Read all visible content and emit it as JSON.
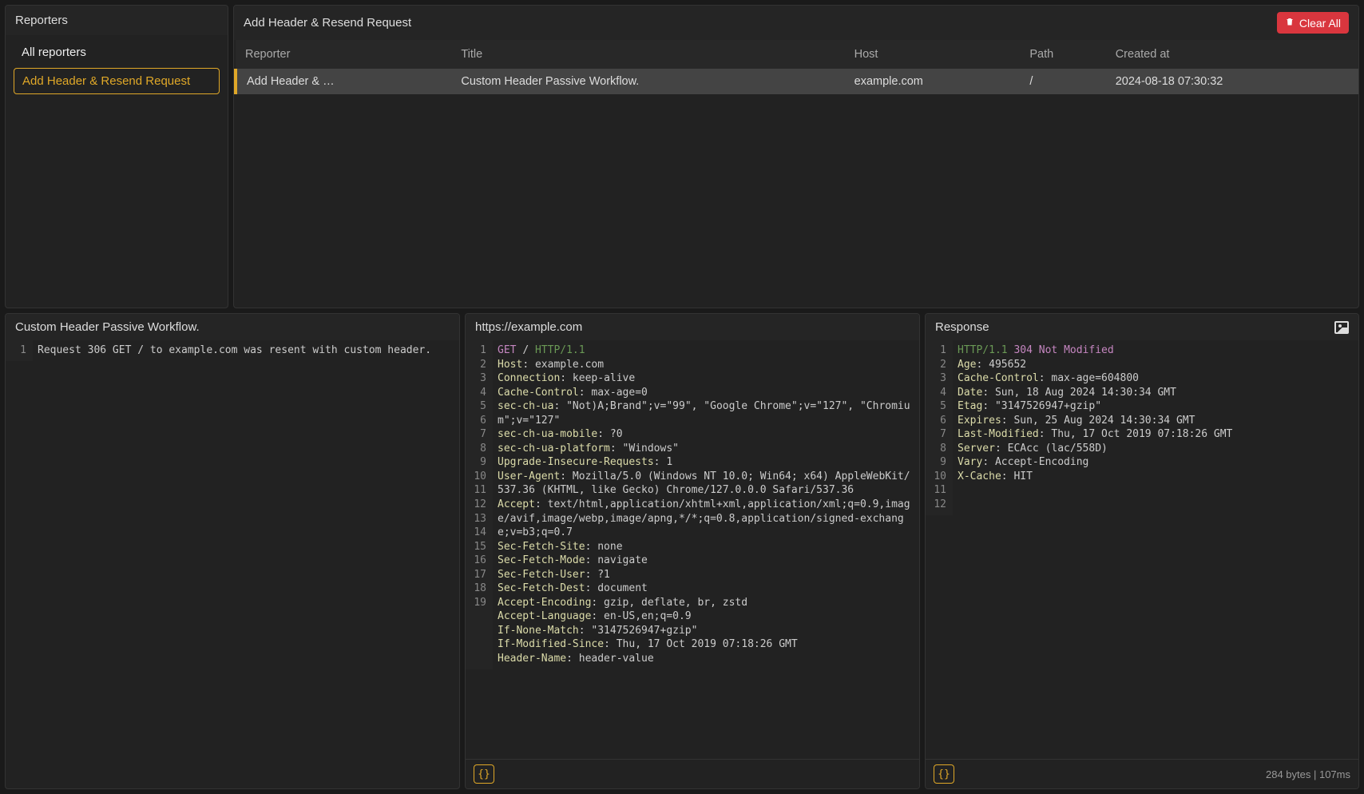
{
  "sidebar": {
    "title": "Reporters",
    "items": [
      {
        "label": "All reporters",
        "selected": false
      },
      {
        "label": "Add Header & Resend Request",
        "selected": true
      }
    ]
  },
  "mainTop": {
    "title": "Add Header & Resend Request",
    "clear_label": "Clear All",
    "columns": [
      "Reporter",
      "Title",
      "Host",
      "Path",
      "Created at"
    ],
    "rows": [
      {
        "reporter": "Add Header & …",
        "title": "Custom Header Passive Workflow.",
        "host": "example.com",
        "path": "/",
        "created": "2024-08-18 07:30:32",
        "selected": true
      }
    ]
  },
  "workflow": {
    "title": "Custom Header Passive Workflow.",
    "lines": [
      "Request 306 GET / to example.com was resent with custom header."
    ]
  },
  "request": {
    "title": "https://example.com",
    "lines": [
      {
        "n": 1,
        "type": "first",
        "method": "GET",
        "path": "/",
        "proto": "HTTP/1.1"
      },
      {
        "n": 2,
        "type": "hdr",
        "name": "Host",
        "value": "example.com"
      },
      {
        "n": 3,
        "type": "hdr",
        "name": "Connection",
        "value": "keep-alive"
      },
      {
        "n": 4,
        "type": "hdr",
        "name": "Cache-Control",
        "value": "max-age=0"
      },
      {
        "n": 5,
        "type": "hdr",
        "name": "sec-ch-ua",
        "value": "\"Not)A;Brand\";v=\"99\", \"Google Chrome\";v=\"127\", \"Chromium\";v=\"127\""
      },
      {
        "n": 6,
        "type": "hdr",
        "name": "sec-ch-ua-mobile",
        "value": "?0"
      },
      {
        "n": 7,
        "type": "hdr",
        "name": "sec-ch-ua-platform",
        "value": "\"Windows\""
      },
      {
        "n": 8,
        "type": "hdr",
        "name": "Upgrade-Insecure-Requests",
        "value": "1"
      },
      {
        "n": 9,
        "type": "hdr",
        "name": "User-Agent",
        "value": "Mozilla/5.0 (Windows NT 10.0; Win64; x64) AppleWebKit/537.36 (KHTML, like Gecko) Chrome/127.0.0.0 Safari/537.36"
      },
      {
        "n": 10,
        "type": "hdr",
        "name": "Accept",
        "value": "text/html,application/xhtml+xml,application/xml;q=0.9,image/avif,image/webp,image/apng,*/*;q=0.8,application/signed-exchange;v=b3;q=0.7"
      },
      {
        "n": 11,
        "type": "hdr",
        "name": "Sec-Fetch-Site",
        "value": "none"
      },
      {
        "n": 12,
        "type": "hdr",
        "name": "Sec-Fetch-Mode",
        "value": "navigate"
      },
      {
        "n": 13,
        "type": "hdr",
        "name": "Sec-Fetch-User",
        "value": "?1"
      },
      {
        "n": 14,
        "type": "hdr",
        "name": "Sec-Fetch-Dest",
        "value": "document"
      },
      {
        "n": 15,
        "type": "hdr",
        "name": "Accept-Encoding",
        "value": "gzip, deflate, br, zstd"
      },
      {
        "n": 16,
        "type": "hdr",
        "name": "Accept-Language",
        "value": "en-US,en;q=0.9"
      },
      {
        "n": 17,
        "type": "hdr",
        "name": "If-None-Match",
        "value": "\"3147526947+gzip\""
      },
      {
        "n": 18,
        "type": "hdr",
        "name": "If-Modified-Since",
        "value": "Thu, 17 Oct 2019 07:18:26 GMT"
      },
      {
        "n": 19,
        "type": "hdr",
        "name": "Header-Name",
        "value": "header-value"
      }
    ],
    "json_label": "{}"
  },
  "response": {
    "title": "Response",
    "lines": [
      {
        "n": 1,
        "type": "first-resp",
        "proto": "HTTP/1.1",
        "status": "304 Not Modified"
      },
      {
        "n": 2,
        "type": "hdr",
        "name": "Age",
        "value": "495652"
      },
      {
        "n": 3,
        "type": "hdr",
        "name": "Cache-Control",
        "value": "max-age=604800"
      },
      {
        "n": 4,
        "type": "hdr",
        "name": "Date",
        "value": "Sun, 18 Aug 2024 14:30:34 GMT"
      },
      {
        "n": 5,
        "type": "hdr",
        "name": "Etag",
        "value": "\"3147526947+gzip\""
      },
      {
        "n": 6,
        "type": "hdr",
        "name": "Expires",
        "value": "Sun, 25 Aug 2024 14:30:34 GMT"
      },
      {
        "n": 7,
        "type": "hdr",
        "name": "Last-Modified",
        "value": "Thu, 17 Oct 2019 07:18:26 GMT"
      },
      {
        "n": 8,
        "type": "hdr",
        "name": "Server",
        "value": "ECAcc (lac/558D)"
      },
      {
        "n": 9,
        "type": "hdr",
        "name": "Vary",
        "value": "Accept-Encoding"
      },
      {
        "n": 10,
        "type": "hdr",
        "name": "X-Cache",
        "value": "HIT"
      },
      {
        "n": 11,
        "type": "blank"
      },
      {
        "n": 12,
        "type": "blank"
      }
    ],
    "json_label": "{}",
    "footer": "284 bytes  |  107ms"
  }
}
